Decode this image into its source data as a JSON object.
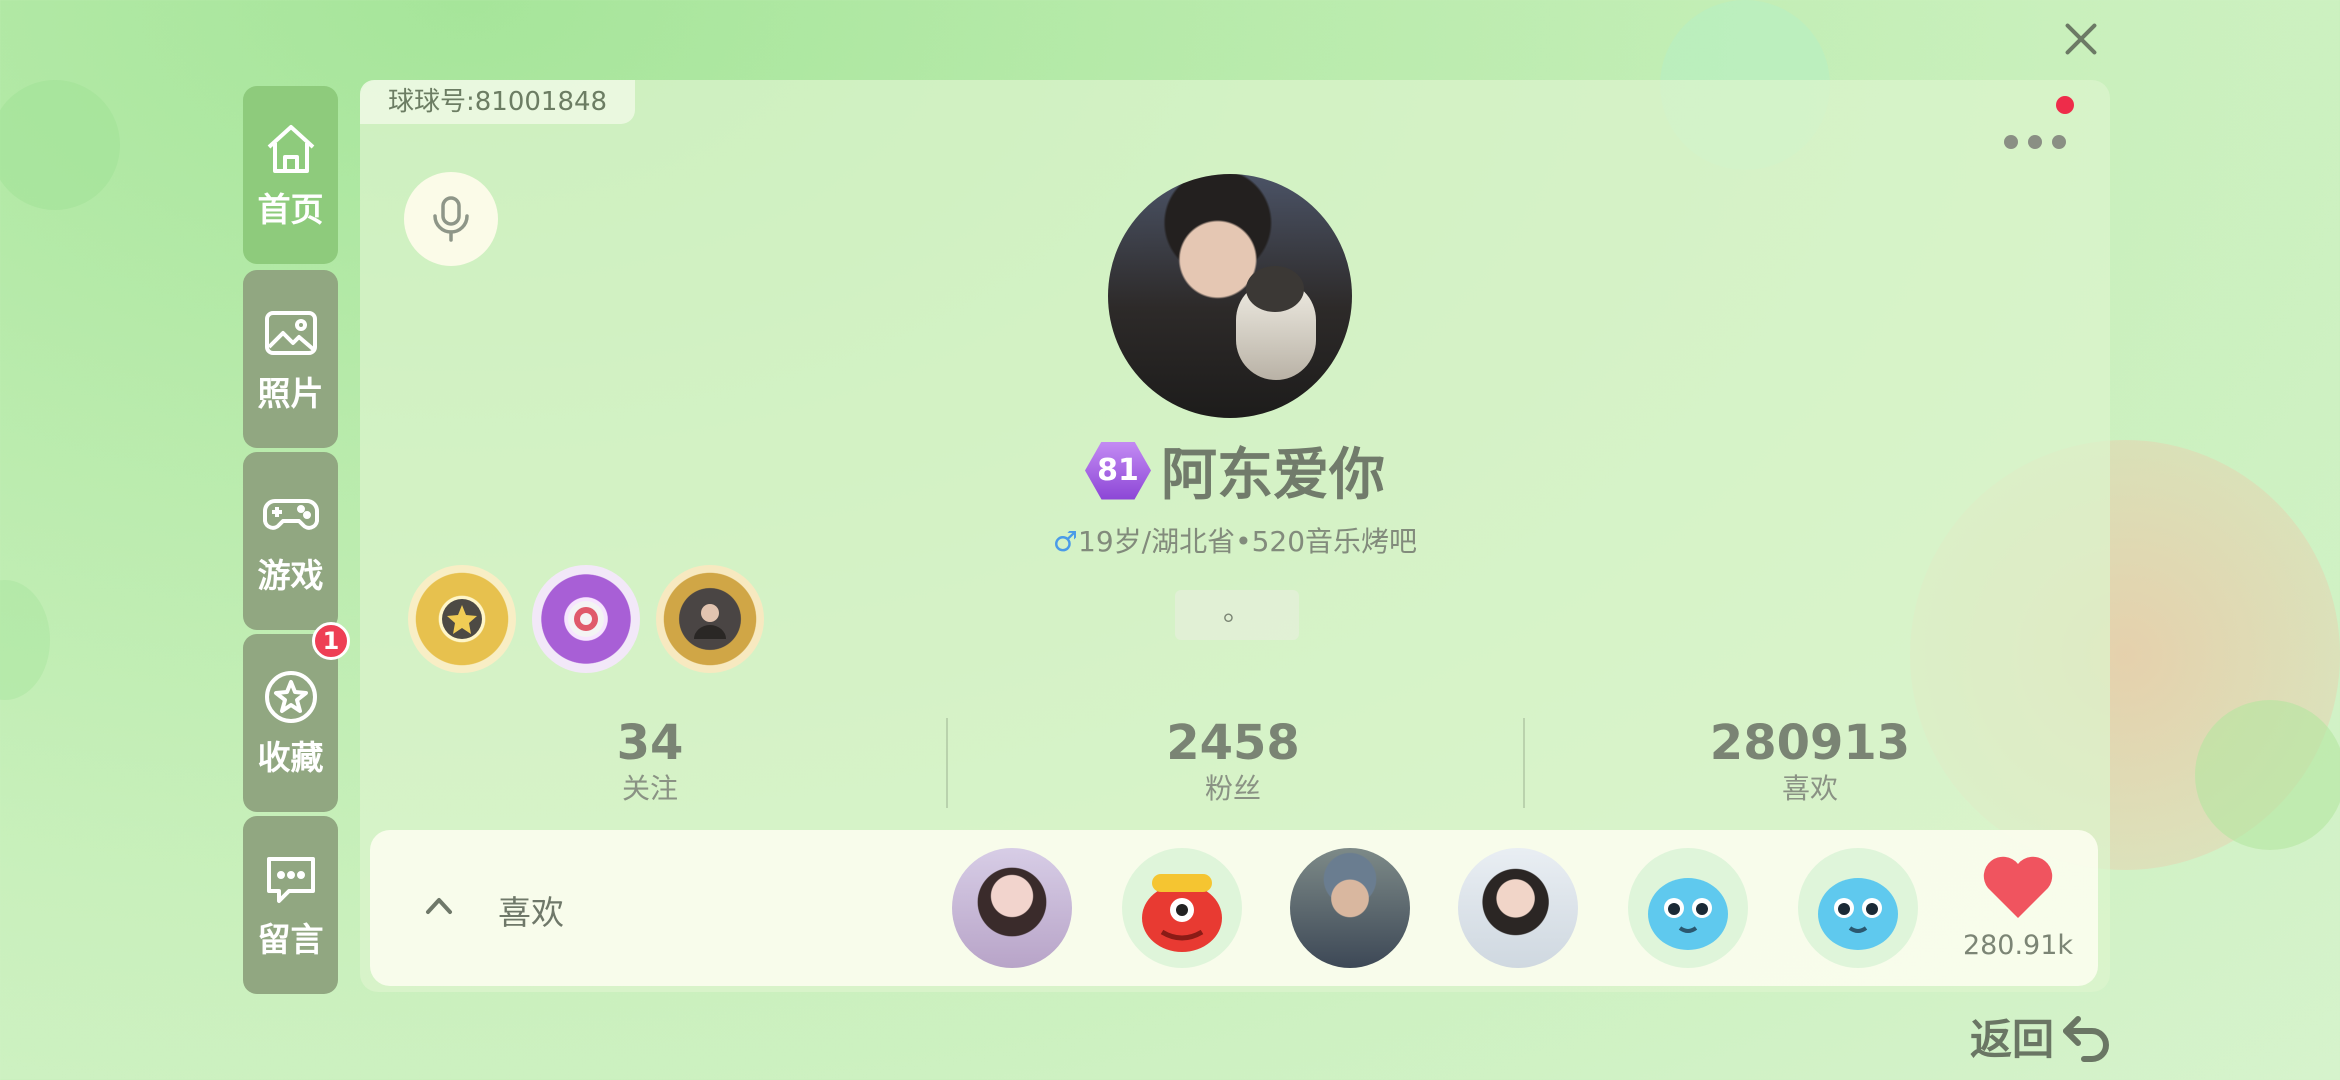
{
  "sidebar": {
    "items": [
      {
        "label": "首页",
        "icon": "home-icon",
        "active": true
      },
      {
        "label": "照片",
        "icon": "photo-icon",
        "active": false
      },
      {
        "label": "游戏",
        "icon": "gamepad-icon",
        "active": false
      },
      {
        "label": "收藏",
        "icon": "star-icon",
        "active": false,
        "badge": "1"
      },
      {
        "label": "留言",
        "icon": "message-icon",
        "active": false
      }
    ]
  },
  "profile": {
    "uid_text": "球球号:81001848",
    "level": "81",
    "nickname": "阿东爱你",
    "gender_symbol": "♂",
    "info_text": "19岁/湖北省•520音乐烤吧",
    "signature": "。"
  },
  "stats": [
    {
      "value": "34",
      "label": "关注"
    },
    {
      "value": "2458",
      "label": "粉丝"
    },
    {
      "value": "280913",
      "label": "喜欢"
    }
  ],
  "likes": {
    "label": "喜欢",
    "total_display": "280.91k"
  },
  "footer": {
    "back_label": "返回"
  },
  "colors": {
    "accent_green": "#8ecb7c",
    "sidebar_gray_green": "#91a781",
    "badge_red": "#ee3f55",
    "level_purple": "#a266e3",
    "heart_red": "#f0545f"
  }
}
